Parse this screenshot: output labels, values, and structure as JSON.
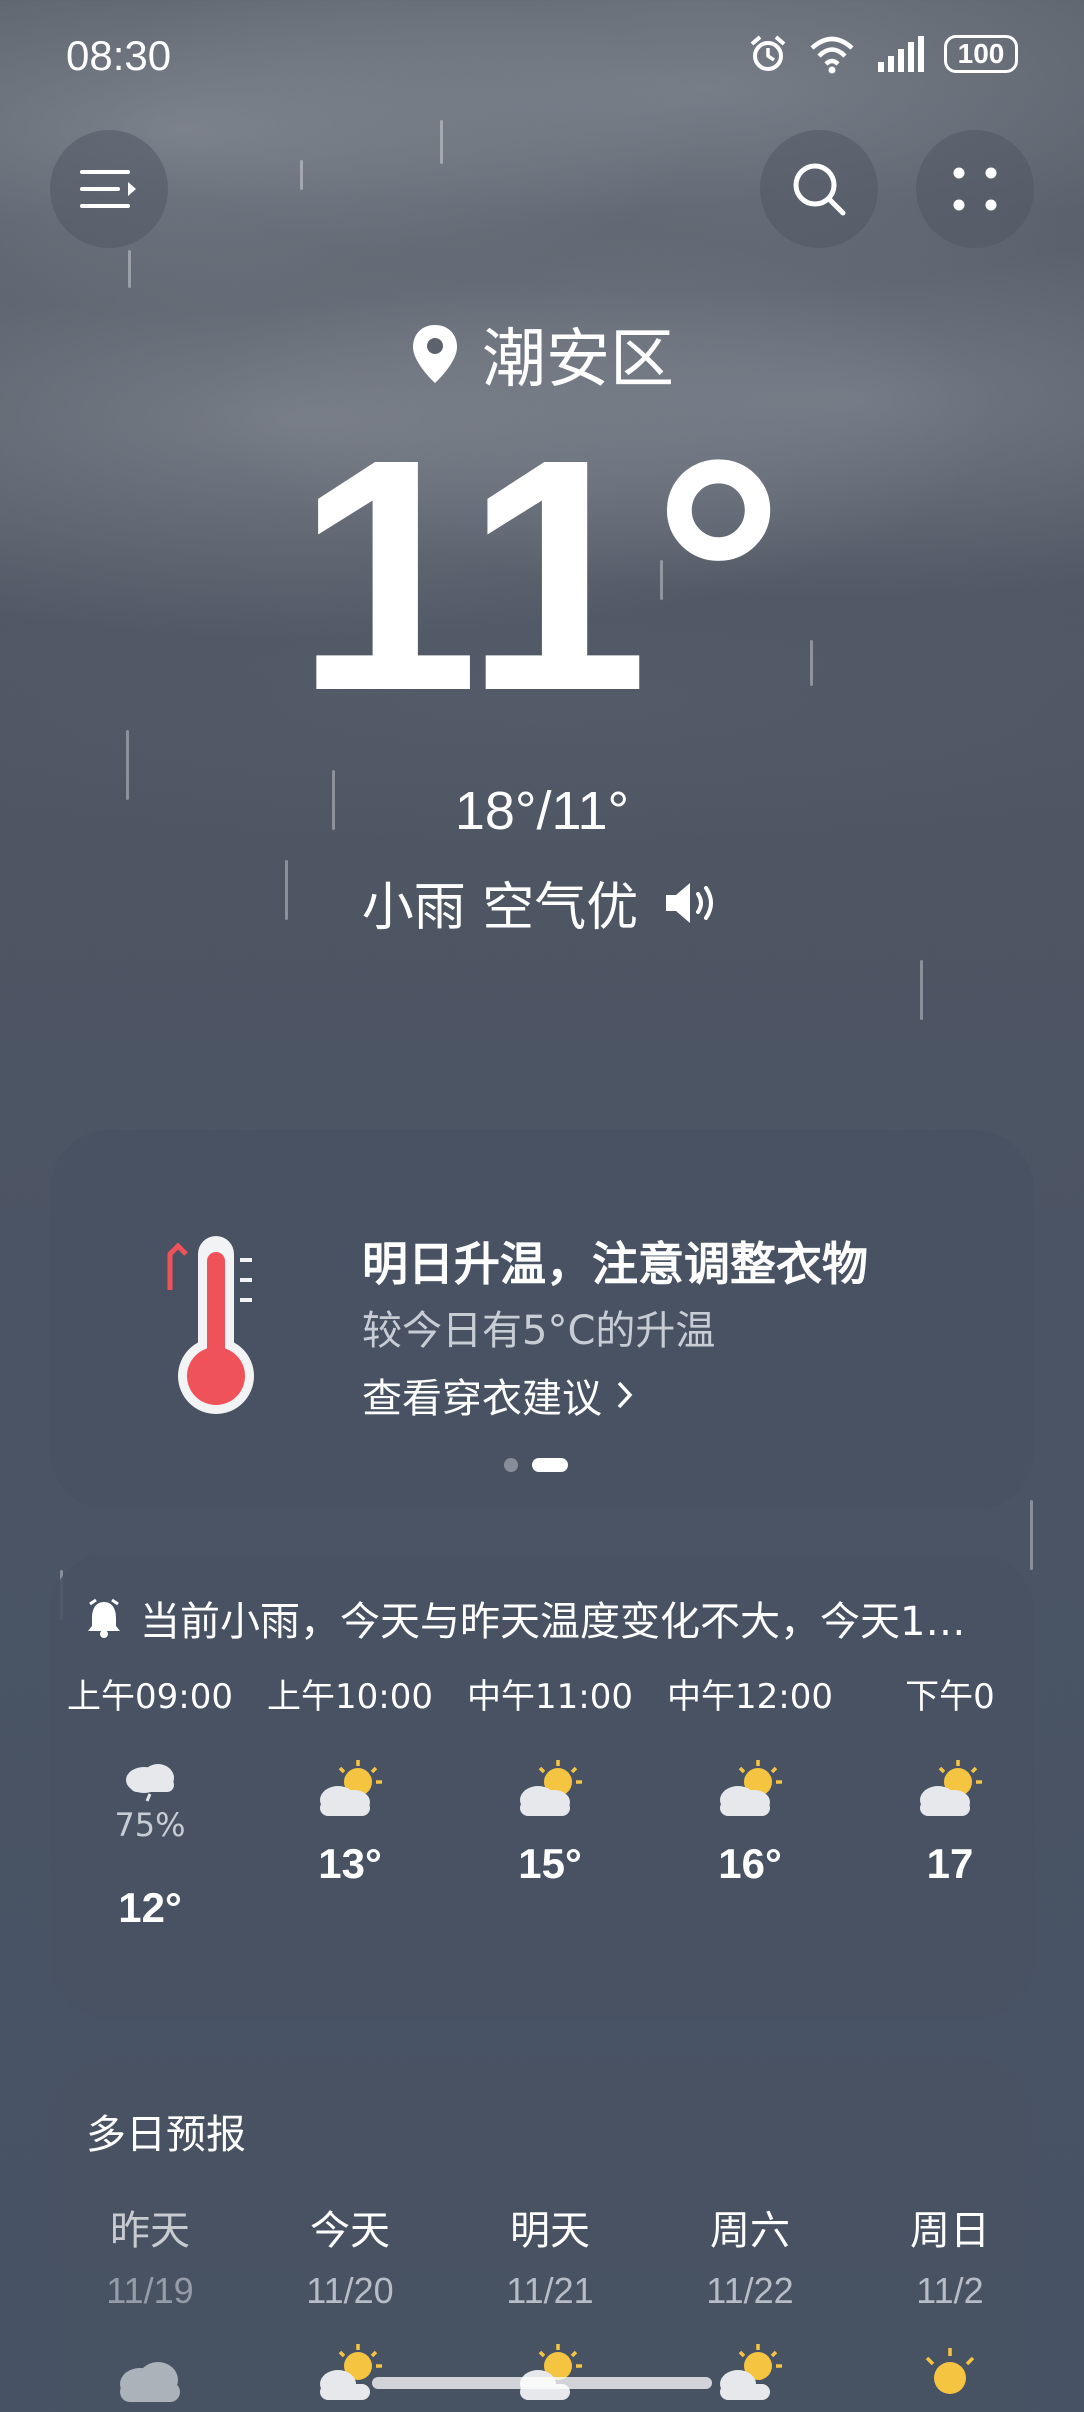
{
  "status_bar": {
    "time": "08:30",
    "battery": "100"
  },
  "location": {
    "name": "潮安区"
  },
  "current": {
    "temperature": "11°",
    "high_low": "18°/11°",
    "condition": "小雨 空气优"
  },
  "tip_card": {
    "title": "明日升温，注意调整衣物",
    "subtitle": "较今日有5°C的升温",
    "link": "查看穿衣建议",
    "page_indicator": {
      "pages": 2,
      "active": 2
    }
  },
  "hourly": {
    "alert": "当前小雨，今天与昨天温度变化不大，今天1…",
    "items": [
      {
        "time": "上午09:00",
        "icon": "rain-cloud-icon",
        "precip": "75%",
        "temp": "12°"
      },
      {
        "time": "上午10:00",
        "icon": "partly-sunny-icon",
        "precip": "",
        "temp": "13°"
      },
      {
        "time": "中午11:00",
        "icon": "partly-sunny-icon",
        "precip": "",
        "temp": "15°"
      },
      {
        "time": "中午12:00",
        "icon": "partly-sunny-icon",
        "precip": "",
        "temp": "16°"
      },
      {
        "time": "下午0",
        "icon": "partly-sunny-icon",
        "precip": "",
        "temp": "17"
      }
    ]
  },
  "daily": {
    "title": "多日预报",
    "items": [
      {
        "name": "昨天",
        "date": "11/19",
        "icon": "cloud-icon",
        "muted": true
      },
      {
        "name": "今天",
        "date": "11/20",
        "icon": "partly-sunny-icon",
        "muted": false
      },
      {
        "name": "明天",
        "date": "11/21",
        "icon": "partly-sunny-icon",
        "muted": false
      },
      {
        "name": "周六",
        "date": "11/22",
        "icon": "partly-sunny-icon",
        "muted": false
      },
      {
        "name": "周日",
        "date": "11/2",
        "icon": "sun-icon",
        "muted": false
      }
    ]
  },
  "colors": {
    "sun": "#f5c542",
    "cloud": "#e6e8ec",
    "thermo_red": "#f0525a"
  }
}
